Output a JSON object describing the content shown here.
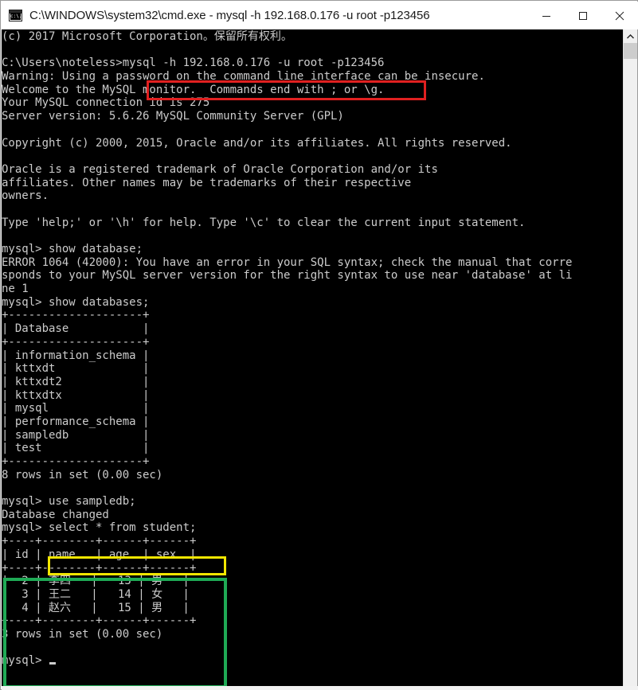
{
  "window": {
    "title": "C:\\WINDOWS\\system32\\cmd.exe - mysql  -h 192.168.0.176 -u root -p123456",
    "icon": "console-icon",
    "controls": {
      "minimize": "minimize-button",
      "maximize": "maximize-button",
      "close": "close-button"
    }
  },
  "terminal": {
    "lines": [
      "(c) 2017 Microsoft Corporation。保留所有权利。",
      "",
      "C:\\Users\\noteless>mysql -h 192.168.0.176 -u root -p123456",
      "Warning: Using a password on the command line interface can be insecure.",
      "Welcome to the MySQL monitor.  Commands end with ; or \\g.",
      "Your MySQL connection id is 275",
      "Server version: 5.6.26 MySQL Community Server (GPL)",
      "",
      "Copyright (c) 2000, 2015, Oracle and/or its affiliates. All rights reserved.",
      "",
      "Oracle is a registered trademark of Oracle Corporation and/or its",
      "affiliates. Other names may be trademarks of their respective",
      "owners.",
      "",
      "Type 'help;' or '\\h' for help. Type '\\c' to clear the current input statement.",
      "",
      "mysql> show database;",
      "ERROR 1064 (42000): You have an error in your SQL syntax; check the manual that corre",
      "sponds to your MySQL server version for the right syntax to use near 'database' at li",
      "ne 1",
      "mysql> show databases;",
      "+--------------------+",
      "| Database           |",
      "+--------------------+",
      "| information_schema |",
      "| kttxdt             |",
      "| kttxdt2            |",
      "| kttxdtx            |",
      "| mysql              |",
      "| performance_schema |",
      "| sampledb           |",
      "| test               |",
      "+--------------------+",
      "8 rows in set (0.00 sec)",
      "",
      "mysql> use sampledb;",
      "Database changed",
      "mysql> select * from student;",
      "+----+--------+------+------+",
      "| id | name   | age  | sex  |",
      "+----+--------+------+------+",
      "|  2 | 李四   |   13 | 男   |",
      "|  3 | 王二   |   14 | 女   |",
      "|  4 | 赵六   |   15 | 男   |",
      "+----+--------+------+------+",
      "3 rows in set (0.00 sec)",
      "",
      "mysql>"
    ],
    "prompt_cursor": "block-cursor"
  },
  "commands": {
    "connect": "mysql -h 192.168.0.176 -u root -p123456",
    "show_database_bad": "show database;",
    "show_databases": "show databases;",
    "use_db": "use sampledb;",
    "select_students": "select * from student;"
  },
  "connection_info": {
    "warning": "Warning: Using a password on the command line interface can be insecure.",
    "welcome": "Welcome to the MySQL monitor.  Commands end with ; or \\g.",
    "connection_id": "Your MySQL connection id is 275",
    "server_version": "Server version: 5.6.26 MySQL Community Server (GPL)",
    "copyright": "Copyright (c) 2000, 2015, Oracle and/or its affiliates. All rights reserved.",
    "trademark": "Oracle is a registered trademark of Oracle Corporation and/or its affiliates. Other names may be trademarks of their respective owners.",
    "help_hint": "Type 'help;' or '\\h' for help. Type '\\c' to clear the current input statement."
  },
  "error": {
    "code": "ERROR 1064 (42000)",
    "message": "You have an error in your SQL syntax; check the manual that corresponds to your MySQL server version for the right syntax to use near 'database' at line 1"
  },
  "databases_result": {
    "column": "Database",
    "rows": [
      "information_schema",
      "kttxdt",
      "kttxdt2",
      "kttxdtx",
      "mysql",
      "performance_schema",
      "sampledb",
      "test"
    ],
    "footer": "8 rows in set (0.00 sec)"
  },
  "use_result": "Database changed",
  "student_result": {
    "columns": [
      "id",
      "name",
      "age",
      "sex"
    ],
    "rows": [
      [
        "2",
        "李四",
        "13",
        "男"
      ],
      [
        "3",
        "王二",
        "14",
        "女"
      ],
      [
        "4",
        "赵六",
        "15",
        "男"
      ]
    ],
    "footer": "3 rows in set (0.00 sec)"
  },
  "annotations": [
    {
      "name": "connect-command-highlight",
      "color": "#e02020"
    },
    {
      "name": "select-query-highlight",
      "color": "#f2e600"
    },
    {
      "name": "result-set-highlight",
      "color": "#1faa55"
    }
  ],
  "scrollbar": {
    "up_arrow": "scroll-up-arrow",
    "thumb": "scroll-thumb"
  }
}
